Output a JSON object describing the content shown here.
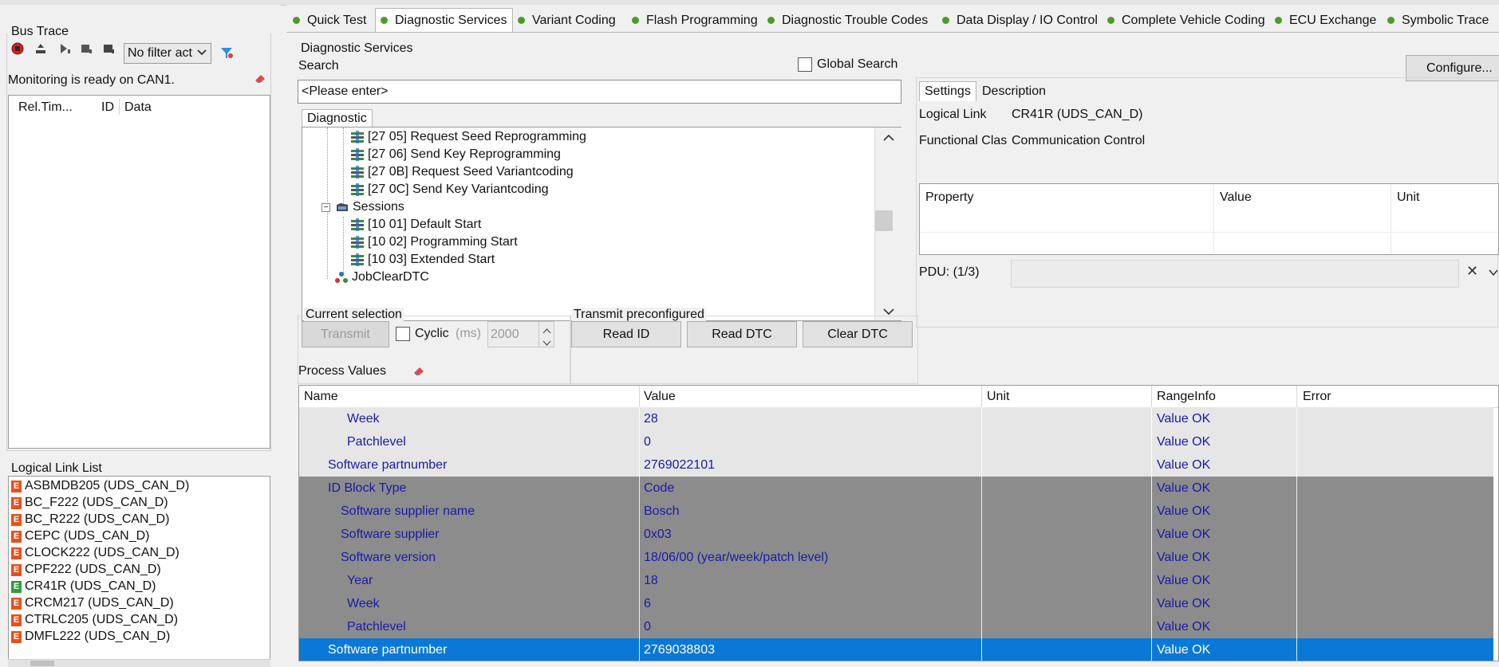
{
  "bus_trace": {
    "title": "Bus Trace",
    "filter_value": "No filter act",
    "status": "Monitoring is ready on CAN1.",
    "columns": [
      "Rel.Tim...",
      "ID",
      "Data"
    ]
  },
  "logical_link_list": {
    "title": "Logical Link List",
    "items": [
      {
        "label": "ASBMDB205 (UDS_CAN_D)",
        "badge": "E",
        "color": "#e8501a"
      },
      {
        "label": "BC_F222 (UDS_CAN_D)",
        "badge": "E",
        "color": "#e8501a"
      },
      {
        "label": "BC_R222 (UDS_CAN_D)",
        "badge": "E",
        "color": "#e8501a"
      },
      {
        "label": "CEPC (UDS_CAN_D)",
        "badge": "E",
        "color": "#e8501a"
      },
      {
        "label": "CLOCK222 (UDS_CAN_D)",
        "badge": "E",
        "color": "#e8501a"
      },
      {
        "label": "CPF222 (UDS_CAN_D)",
        "badge": "E",
        "color": "#e8501a"
      },
      {
        "label": "CR41R (UDS_CAN_D)",
        "badge": "E",
        "color": "#2e9e3a"
      },
      {
        "label": "CRCM217 (UDS_CAN_D)",
        "badge": "E",
        "color": "#e8501a"
      },
      {
        "label": "CTRLC205 (UDS_CAN_D)",
        "badge": "E",
        "color": "#e8501a"
      },
      {
        "label": "DMFL222 (UDS_CAN_D)",
        "badge": "E",
        "color": "#e8501a"
      }
    ]
  },
  "tabs": [
    {
      "label": "Quick Test"
    },
    {
      "label": "Diagnostic Services"
    },
    {
      "label": "Variant Coding"
    },
    {
      "label": "Flash Programming"
    },
    {
      "label": "Diagnostic Trouble Codes"
    },
    {
      "label": "Data Display / IO Control"
    },
    {
      "label": "Complete Vehicle Coding"
    },
    {
      "label": "ECU Exchange"
    },
    {
      "label": "Symbolic Trace"
    }
  ],
  "diag": {
    "title": "Diagnostic Services",
    "search_label": "Search",
    "global_search": "Global Search",
    "search_placeholder": "<Please enter>",
    "tree_tab": "Diagnostic",
    "tree": [
      {
        "label": "[27 05] Request Seed Reprogramming"
      },
      {
        "label": "[27 06] Send Key Reprogramming"
      },
      {
        "label": "[27 0B] Request Seed Variantcoding"
      },
      {
        "label": "[27 0C] Send Key Variantcoding"
      },
      {
        "label": "Sessions"
      },
      {
        "label": "[10 01] Default Start"
      },
      {
        "label": "[10 02] Programming Start"
      },
      {
        "label": "[10 03] Extended Start"
      },
      {
        "label": "JobClearDTC"
      }
    ]
  },
  "settings": {
    "configure": "Configure...",
    "tab_settings": "Settings",
    "tab_description": "Description",
    "logical_link_label": "Logical Link",
    "logical_link_value": "CR41R (UDS_CAN_D)",
    "functional_class_label": "Functional Clas",
    "functional_class_value": "Communication Control",
    "columns": [
      "Property",
      "Value",
      "Unit"
    ],
    "pdu": "PDU: (1/3)"
  },
  "current_selection": {
    "title": "Current selection",
    "transmit": "Transmit",
    "cyclic": "Cyclic",
    "unit": "(ms)",
    "interval": "2000"
  },
  "transmit_preconfigured": {
    "title": "Transmit preconfigured",
    "read_id": "Read ID",
    "read_dtc": "Read DTC",
    "clear_dtc": "Clear DTC"
  },
  "process_values": {
    "title": "Process Values",
    "columns": [
      "Name",
      "Value",
      "Unit",
      "RangeInfo",
      "Error"
    ],
    "rows": [
      {
        "name": "Week",
        "value": "28",
        "unit": "",
        "range": "Value OK",
        "error": "",
        "style": "light",
        "indent": 2
      },
      {
        "name": "Patchlevel",
        "value": "0",
        "unit": "",
        "range": "Value OK",
        "error": "",
        "style": "light",
        "indent": 2
      },
      {
        "name": "Software partnumber",
        "value": "2769022101",
        "unit": "",
        "range": "Value OK",
        "error": "",
        "style": "light",
        "indent": 1
      },
      {
        "name": "ID Block Type",
        "value": "Code",
        "unit": "",
        "range": "Value OK",
        "error": "",
        "style": "dark",
        "indent": 1
      },
      {
        "name": "Software supplier name",
        "value": "Bosch",
        "unit": "",
        "range": "Value OK",
        "error": "",
        "style": "dark",
        "indent": 1.5
      },
      {
        "name": "Software supplier",
        "value": "0x03",
        "unit": "",
        "range": "Value OK",
        "error": "",
        "style": "dark",
        "indent": 1.5
      },
      {
        "name": "Software version",
        "value": "18/06/00 (year/week/patch level)",
        "unit": "",
        "range": "Value OK",
        "error": "",
        "style": "dark",
        "indent": 1.5
      },
      {
        "name": "Year",
        "value": "18",
        "unit": "",
        "range": "Value OK",
        "error": "",
        "style": "dark",
        "indent": 2
      },
      {
        "name": "Week",
        "value": "6",
        "unit": "",
        "range": "Value OK",
        "error": "",
        "style": "dark",
        "indent": 2
      },
      {
        "name": "Patchlevel",
        "value": "0",
        "unit": "",
        "range": "Value OK",
        "error": "",
        "style": "dark",
        "indent": 2
      },
      {
        "name": "Software partnumber",
        "value": "2769038803",
        "unit": "",
        "range": "Value OK",
        "error": "",
        "style": "sel",
        "indent": 1
      }
    ]
  }
}
